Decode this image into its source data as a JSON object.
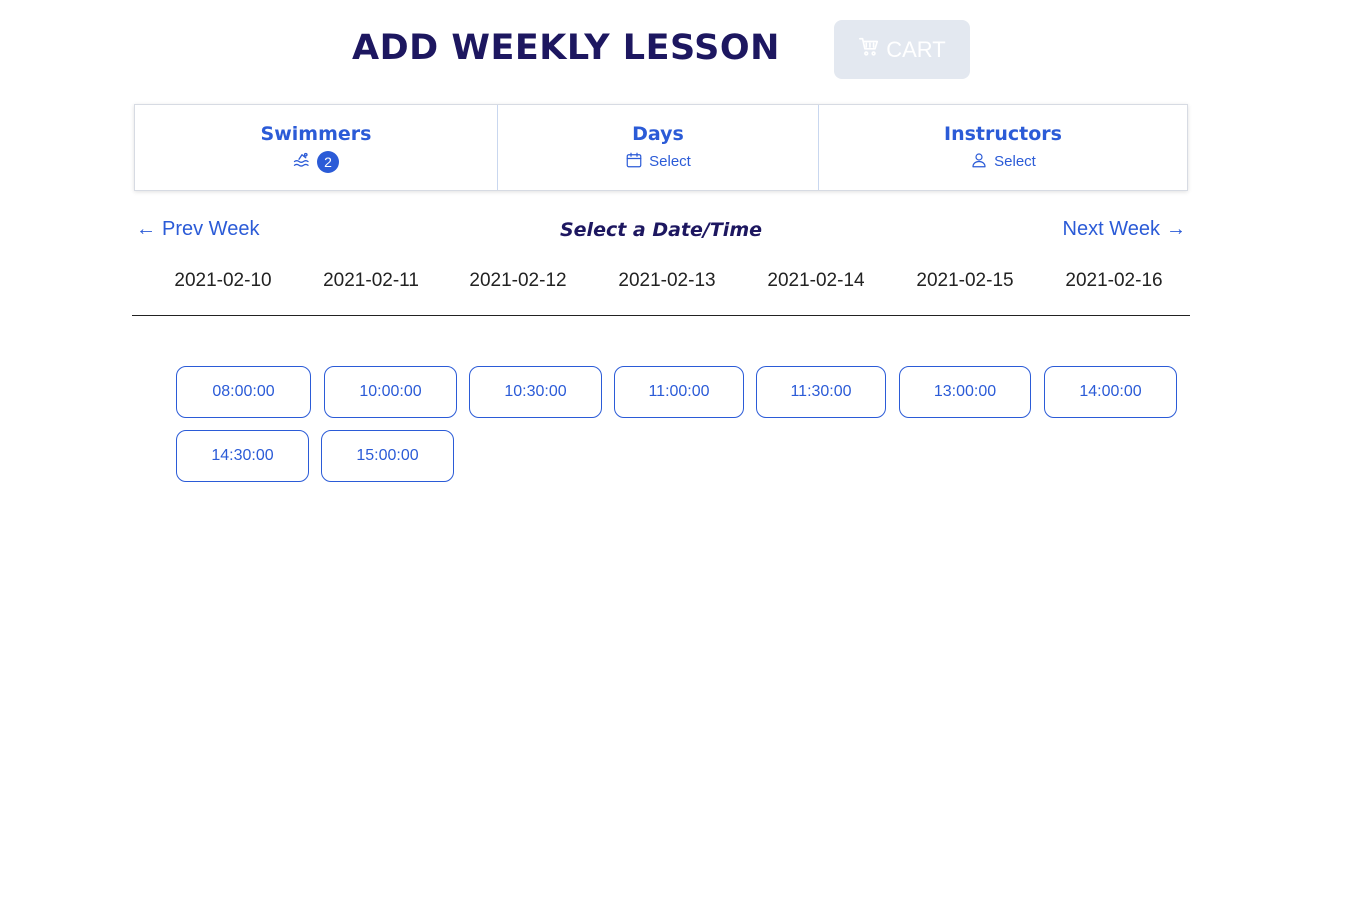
{
  "header": {
    "title": "ADD WEEKLY LESSON",
    "cart_label": "CART",
    "cart_icon": "cart-icon"
  },
  "filters": {
    "swimmers": {
      "label": "Swimmers",
      "icon": "swimming-icon",
      "count": "2"
    },
    "days": {
      "label": "Days",
      "icon": "calendar-icon",
      "value": "Select"
    },
    "instructors": {
      "label": "Instructors",
      "icon": "person-icon",
      "value": "Select"
    }
  },
  "week": {
    "prev_label": "Prev Week",
    "next_label": "Next Week",
    "heading": "Select a Date/Time"
  },
  "dates": [
    "2021-02-10",
    "2021-02-11",
    "2021-02-12",
    "2021-02-13",
    "2021-02-14",
    "2021-02-15",
    "2021-02-16"
  ],
  "time_slots": [
    "08:00:00",
    "10:00:00",
    "10:30:00",
    "11:00:00",
    "11:30:00",
    "13:00:00",
    "14:00:00",
    "14:30:00",
    "15:00:00"
  ],
  "colors": {
    "accent": "#2b5bd7",
    "title": "#1d1760",
    "cart_bg": "#e3e8f0"
  }
}
